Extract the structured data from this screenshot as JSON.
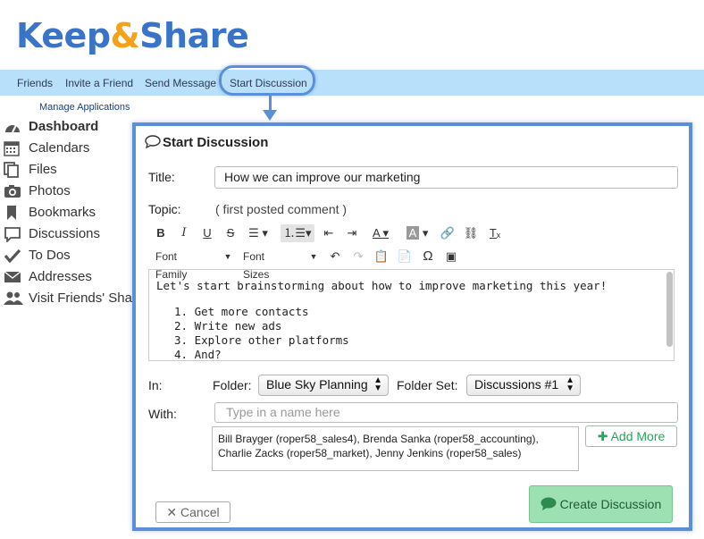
{
  "logo": {
    "part1": "Keep",
    "amp": "&",
    "part2": "Share"
  },
  "nav": {
    "items": [
      "Friends",
      "Invite a Friend",
      "Send Message",
      "Start Discussion"
    ]
  },
  "sidebar": {
    "manage_apps": "Manage Applications",
    "items": [
      {
        "label": "Dashboard",
        "icon": "dashboard-icon"
      },
      {
        "label": "Calendars",
        "icon": "calendar-icon"
      },
      {
        "label": "Files",
        "icon": "files-icon"
      },
      {
        "label": "Photos",
        "icon": "camera-icon"
      },
      {
        "label": "Bookmarks",
        "icon": "bookmark-icon"
      },
      {
        "label": "Discussions",
        "icon": "chat-icon"
      },
      {
        "label": "To Dos",
        "icon": "checkmark-icon"
      },
      {
        "label": "Addresses",
        "icon": "envelope-icon"
      },
      {
        "label": "Visit Friends' Sha",
        "icon": "people-icon"
      }
    ]
  },
  "dialog": {
    "title": "Start Discussion",
    "title_label": "Title:",
    "title_value": "How we can improve our marketing",
    "topic_label": "Topic:",
    "topic_hint": "( first posted comment )",
    "font_family": "Font Family",
    "font_sizes": "Font Sizes",
    "editor": {
      "intro": "Let's start brainstorming about how to improve marketing this year!",
      "list": [
        "1.  Get more contacts",
        "2.  Write new ads",
        "3.  Explore other platforms",
        "4.  And?"
      ]
    },
    "in_label": "In:",
    "folder_label": "Folder:",
    "folder_value": "Blue Sky Planning",
    "folder_set_label": "Folder Set:",
    "folder_set_value": "Discussions #1",
    "with_label": "With:",
    "with_placeholder": "Type in a name here",
    "recipients": "Bill Brayger (roper58_sales4), Brenda Sanka (roper58_accounting), Charlie Zacks (roper58_market), Jenny Jenkins (roper58_sales)",
    "add_more": "Add More",
    "cancel": "Cancel",
    "create": "Create Discussion"
  },
  "colors": {
    "accent": "#5b8fdb",
    "nav_bg": "#b9e0fa",
    "create_btn": "#9de0b2",
    "add_more_text": "#2aa45a"
  }
}
